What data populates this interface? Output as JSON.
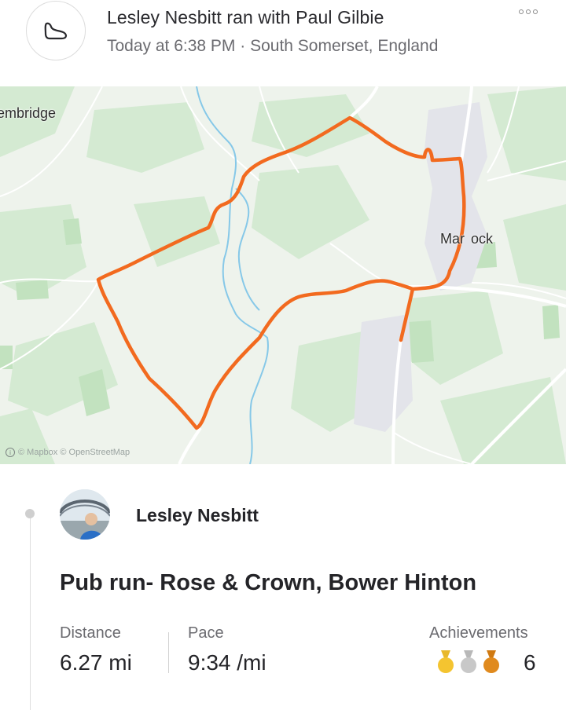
{
  "header": {
    "title": "Lesley Nesbitt ran with Paul Gilbie",
    "subtitle": "Today at 6:38 PM · South Somerset, England",
    "activity_icon": "shoe-icon",
    "more_icon": "more-options-icon"
  },
  "map": {
    "labels": {
      "west_town": "embridge",
      "east_town_left": "Mar",
      "east_town_right": "ock"
    },
    "attribution": "© Mapbox © OpenStreetMap",
    "colors": {
      "route": "#f26a1f",
      "land": "#eef3ec",
      "green": "#cfe8cd",
      "water": "#86c8e8",
      "road": "#ffffff"
    }
  },
  "post": {
    "athlete_name": "Lesley Nesbitt",
    "title": "Pub run- Rose & Crown, Bower Hinton",
    "stats": {
      "distance_label": "Distance",
      "distance_value": "6.27 mi",
      "pace_label": "Pace",
      "pace_value": "9:34 /mi",
      "achievements_label": "Achievements",
      "achievements_count": "6"
    },
    "medal_colors": {
      "gold": "#f4c430",
      "silver": "#c8c8c8",
      "bronze": "#e08a1e"
    }
  }
}
